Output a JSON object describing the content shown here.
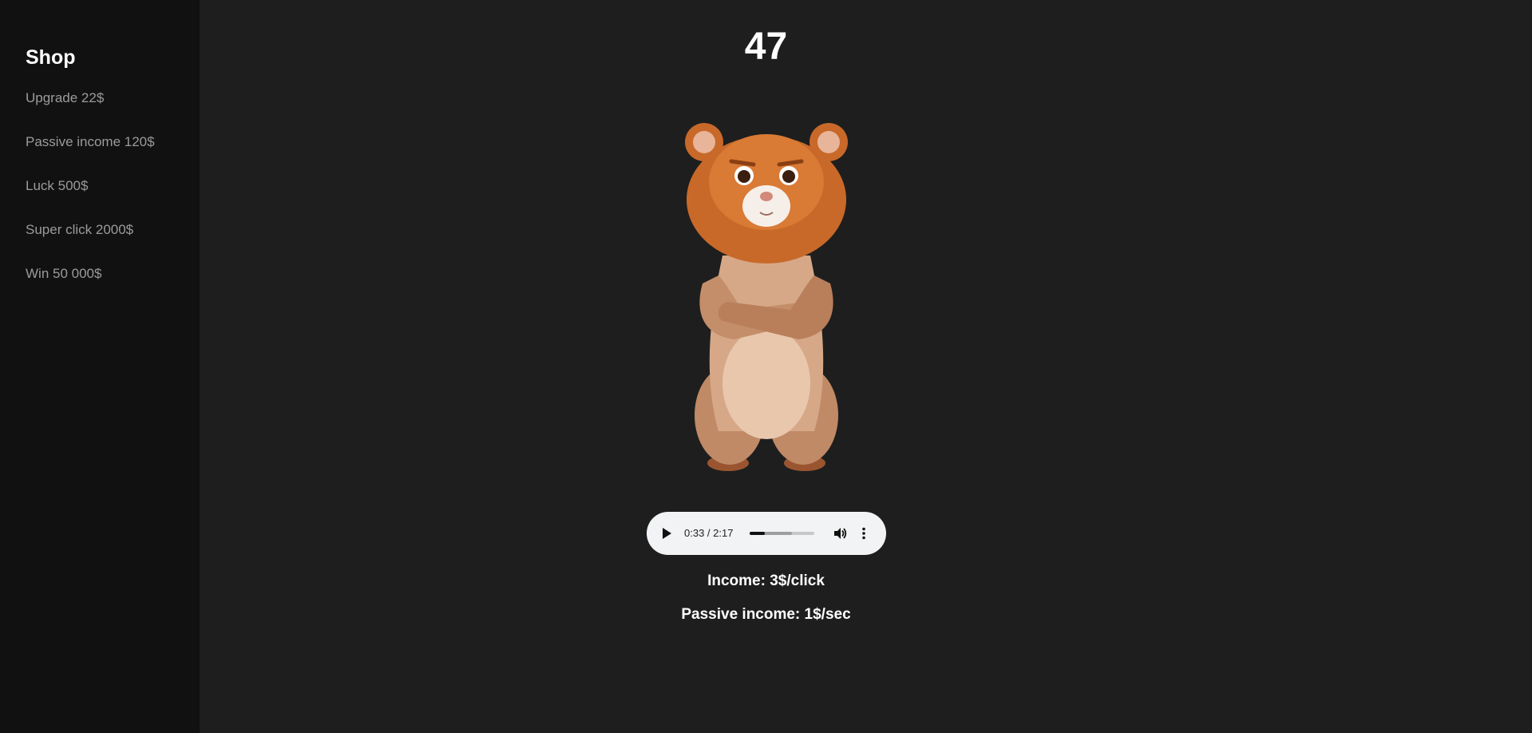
{
  "shop": {
    "title": "Shop",
    "items": [
      {
        "label": "Upgrade 22$"
      },
      {
        "label": "Passive income 120$"
      },
      {
        "label": "Luck 500$"
      },
      {
        "label": "Super click 2000$"
      },
      {
        "label": "Win 50 000$"
      }
    ]
  },
  "game": {
    "score": "47",
    "hamster_icon": "hamster-icon"
  },
  "audio": {
    "time": "0:33 / 2:17",
    "played_fraction": 0.24,
    "buffered_fraction": 0.65
  },
  "stats": {
    "income_click": "Income: 3$/click",
    "income_passive": "Passive income: 1$/sec"
  },
  "colors": {
    "background": "#1e1e1e",
    "sidebar": "#111111",
    "shop_item": "#9b9b9b",
    "text": "#ffffff",
    "hamster_fur": "#c8692a",
    "hamster_body": "#e6c2a6"
  }
}
